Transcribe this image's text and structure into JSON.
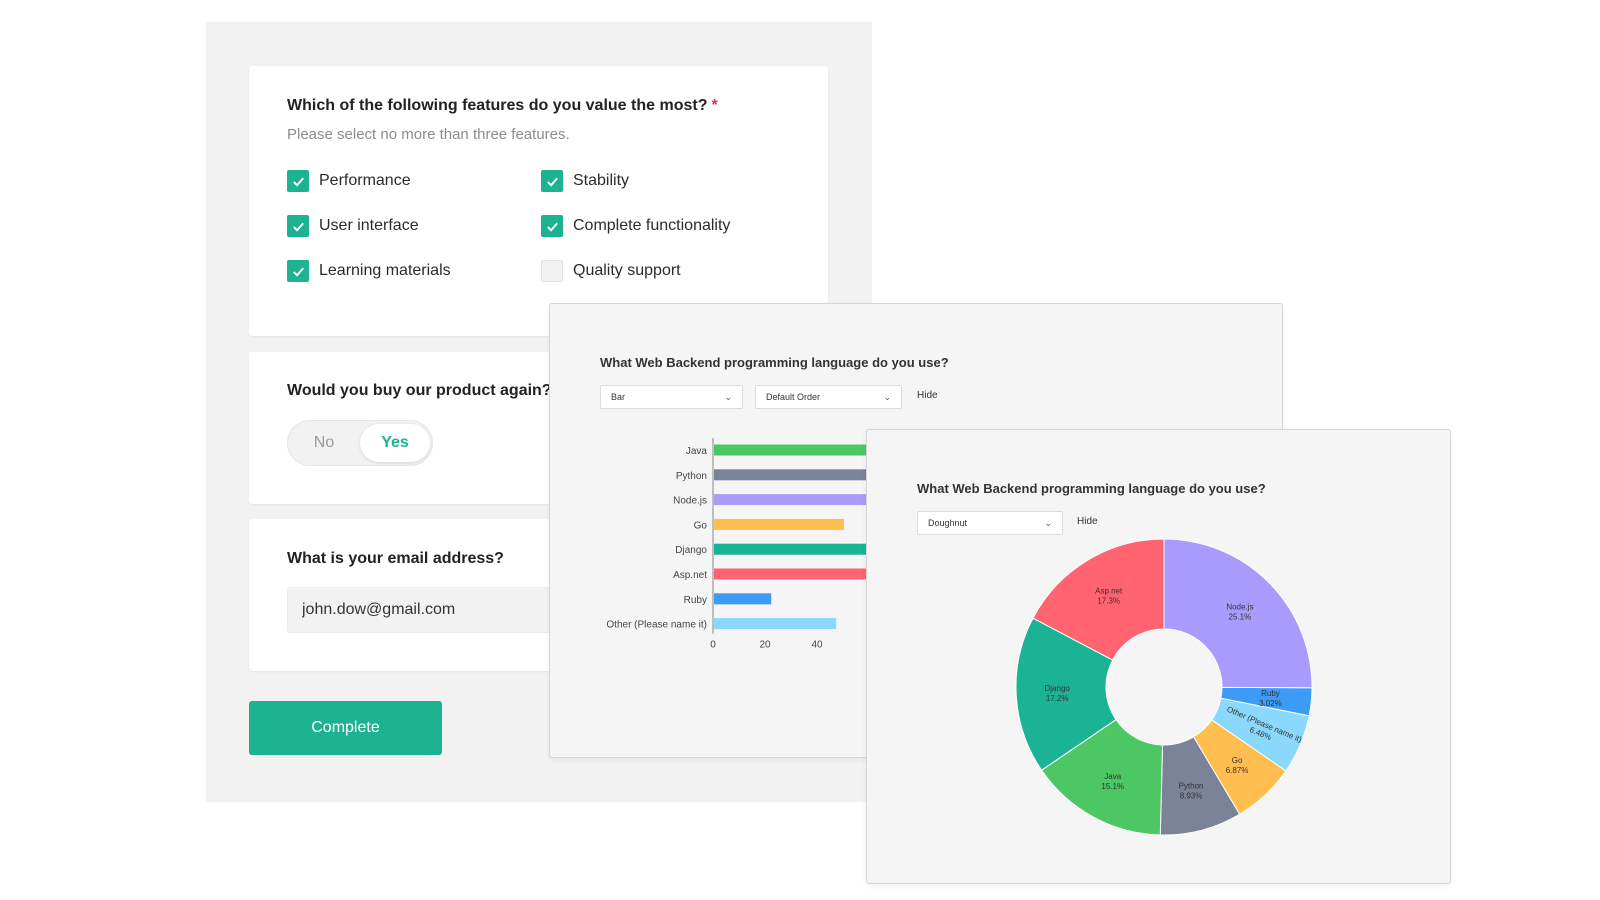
{
  "survey": {
    "q1": {
      "title": "Which of the following features do you value the most?",
      "required_mark": "*",
      "hint": "Please select no more than three features.",
      "options": [
        {
          "label": "Performance",
          "checked": true
        },
        {
          "label": "Stability",
          "checked": true
        },
        {
          "label": "User interface",
          "checked": true
        },
        {
          "label": "Complete functionality",
          "checked": true
        },
        {
          "label": "Learning materials",
          "checked": true
        },
        {
          "label": "Quality support",
          "checked": false
        }
      ]
    },
    "q2": {
      "title": "Would you buy our product again?",
      "no_label": "No",
      "yes_label": "Yes",
      "selected": "Yes"
    },
    "q3": {
      "title": "What is your email address?",
      "value": "john.dow@gmail.com"
    },
    "complete_label": "Complete"
  },
  "bar_panel": {
    "title": "What Web Backend programming language do you use?",
    "chart_type_select": "Bar",
    "order_select": "Default Order",
    "hide_label": "Hide"
  },
  "donut_panel": {
    "title": "What Web Backend programming language do you use?",
    "chart_type_select": "Doughnut",
    "hide_label": "Hide"
  },
  "colors": {
    "accent": "#1db390",
    "required": "#e0314a"
  },
  "chart_data": [
    {
      "type": "bar",
      "orientation": "horizontal",
      "categories": [
        "Java",
        "Python",
        "Node.js",
        "Go",
        "Django",
        "Asp.net",
        "Ruby",
        "Other (Please name it)"
      ],
      "values": [
        60,
        60,
        60,
        50,
        60,
        60,
        22,
        47
      ],
      "x_ticks": [
        0,
        20,
        40
      ],
      "colors": [
        "#4cc764",
        "#7a8398",
        "#a99bfc",
        "#ffbe4f",
        "#1ab394",
        "#ff6470",
        "#3c9bf5",
        "#8ad9fc"
      ]
    },
    {
      "type": "pie",
      "variant": "doughnut",
      "slices": [
        {
          "label": "Node.js",
          "value": 25.1,
          "value_label": "25.1%",
          "color": "#a99bfc"
        },
        {
          "label": "Ruby",
          "value": 3.02,
          "value_label": "3.02%",
          "color": "#3c9bf5"
        },
        {
          "label": "Other (Please name it)",
          "value": 6.48,
          "value_label": "6.48%",
          "color": "#8ad9fc"
        },
        {
          "label": "Go",
          "value": 6.87,
          "value_label": "6.87%",
          "color": "#ffbe4f"
        },
        {
          "label": "Python",
          "value": 8.93,
          "value_label": "8.93%",
          "color": "#7a8398"
        },
        {
          "label": "Java",
          "value": 15.1,
          "value_label": "15.1%",
          "color": "#4cc764"
        },
        {
          "label": "Django",
          "value": 17.2,
          "value_label": "17.2%",
          "color": "#1ab394"
        },
        {
          "label": "Asp.net",
          "value": 17.3,
          "value_label": "17.3%",
          "color": "#ff6470"
        }
      ]
    }
  ]
}
